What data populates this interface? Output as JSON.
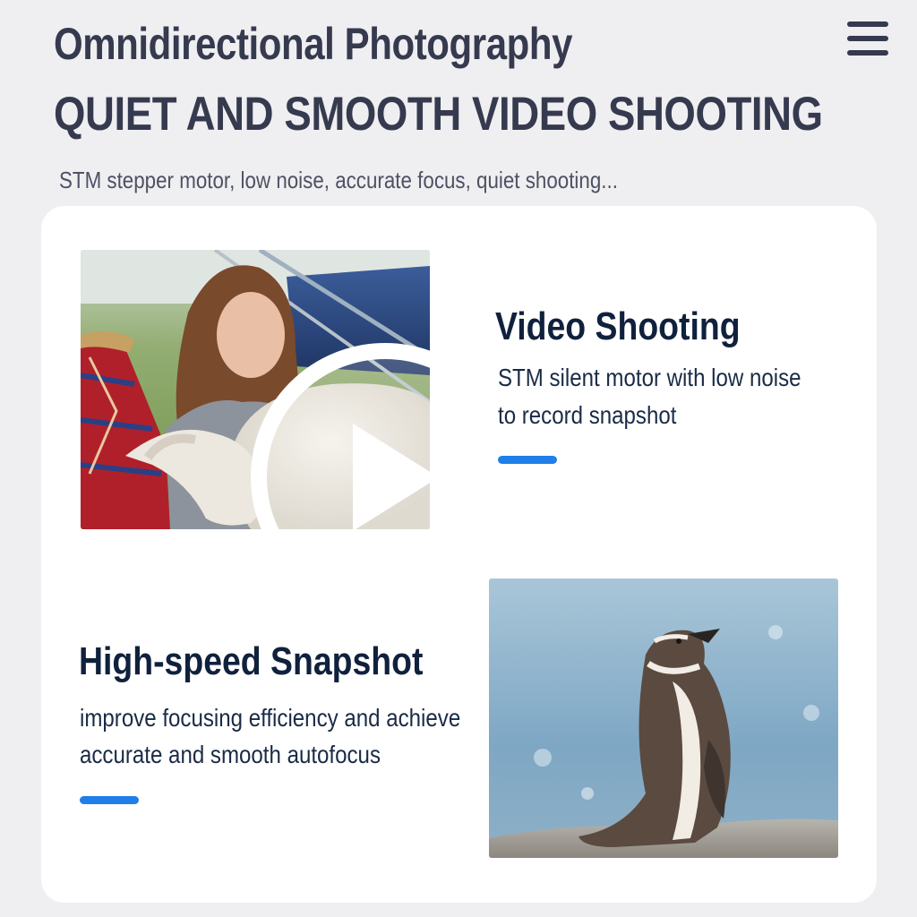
{
  "header": {
    "title_line1": "Omnidirectional Photography",
    "title_line2": "QUIET AND SMOOTH VIDEO SHOOTING",
    "subtitle": "STM stepper motor, low noise, accurate focus, quiet shooting..."
  },
  "menu": {
    "icon": "hamburger-menu-icon"
  },
  "features": [
    {
      "title": "Video Shooting",
      "description_line1": "STM silent motor with low noise",
      "description_line2": "to record snapshot",
      "media_icon": "play-icon"
    },
    {
      "title": "High-speed Snapshot",
      "description_line1": "improve focusing efficiency and achieve",
      "description_line2": "accurate and smooth autofocus"
    }
  ],
  "colors": {
    "background": "#efeff1",
    "card": "#ffffff",
    "heading": "#363a4f",
    "feature_title": "#10213d",
    "accent": "#1f7ee8"
  }
}
